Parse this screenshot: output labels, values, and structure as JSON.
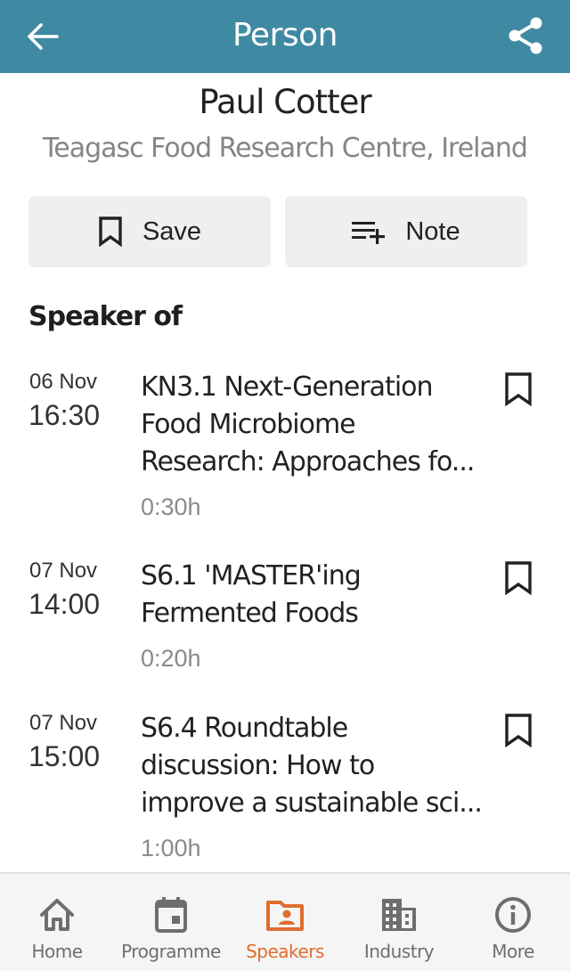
{
  "header": {
    "title": "Person",
    "back_icon": "arrow-left-icon",
    "share_icon": "share-icon",
    "bg_color": "#3f8aa2"
  },
  "person": {
    "name": "Paul Cotter",
    "organization": "Teagasc Food Research Centre, Ireland"
  },
  "actions": {
    "save_label": "Save",
    "save_icon": "bookmark-icon",
    "note_label": "Note",
    "note_icon": "playlist-add-icon"
  },
  "speaker_section": {
    "title": "Speaker of",
    "sessions": [
      {
        "date": "06 Nov",
        "time": "16:30",
        "title_lines": [
          "KN3.1 Next-Generation",
          "Food Microbiome",
          "Research: Approaches fo..."
        ],
        "duration": "0:30h",
        "bookmarked": false
      },
      {
        "date": "07 Nov",
        "time": "14:00",
        "title_lines": [
          "S6.1 'MASTER'ing",
          "Fermented Foods"
        ],
        "duration": "0:20h",
        "bookmarked": false
      },
      {
        "date": "07 Nov",
        "time": "15:00",
        "title_lines": [
          "S6.4 Roundtable",
          "discussion: How to",
          "improve a sustainable sci..."
        ],
        "duration": "1:00h",
        "bookmarked": false
      }
    ]
  },
  "tabbar": {
    "active_color": "#e06d2e",
    "inactive_color": "#6e6e6e",
    "tabs": [
      {
        "label": "Home",
        "icon": "home-icon",
        "active": false
      },
      {
        "label": "Programme",
        "icon": "calendar-icon",
        "active": false
      },
      {
        "label": "Speakers",
        "icon": "speaker-folder-icon",
        "active": true
      },
      {
        "label": "Industry",
        "icon": "building-icon",
        "active": false
      },
      {
        "label": "More",
        "icon": "info-icon",
        "active": false
      }
    ]
  }
}
